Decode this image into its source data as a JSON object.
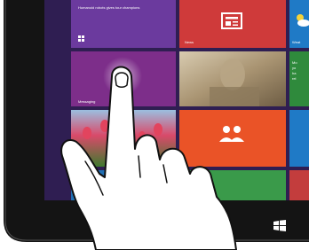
{
  "tiles": {
    "top_banner_text": "Humanoid robots gives tour champions",
    "news_label": "News",
    "messaging_label": "Messaging",
    "weather_label": "Weat",
    "right_partial_lines": [
      "Mo",
      "yo",
      "ha",
      "rel"
    ]
  },
  "icons": {
    "news": "newspaper-icon",
    "people": "people-icon",
    "windows_button": "windows-logo-icon",
    "small_grid": "app-grid-icon",
    "weather": "cloud-sun-icon"
  },
  "colors": {
    "purple_tile": "#6b3a9e",
    "magenta_tile": "#7d2e8a",
    "red_tile": "#cf3a3a",
    "orange_tile": "#ea5327",
    "blue_tile": "#1f7ac6",
    "green_tile": "#2f8a3c",
    "background": "#2f1e52",
    "bezel": "#141414"
  }
}
